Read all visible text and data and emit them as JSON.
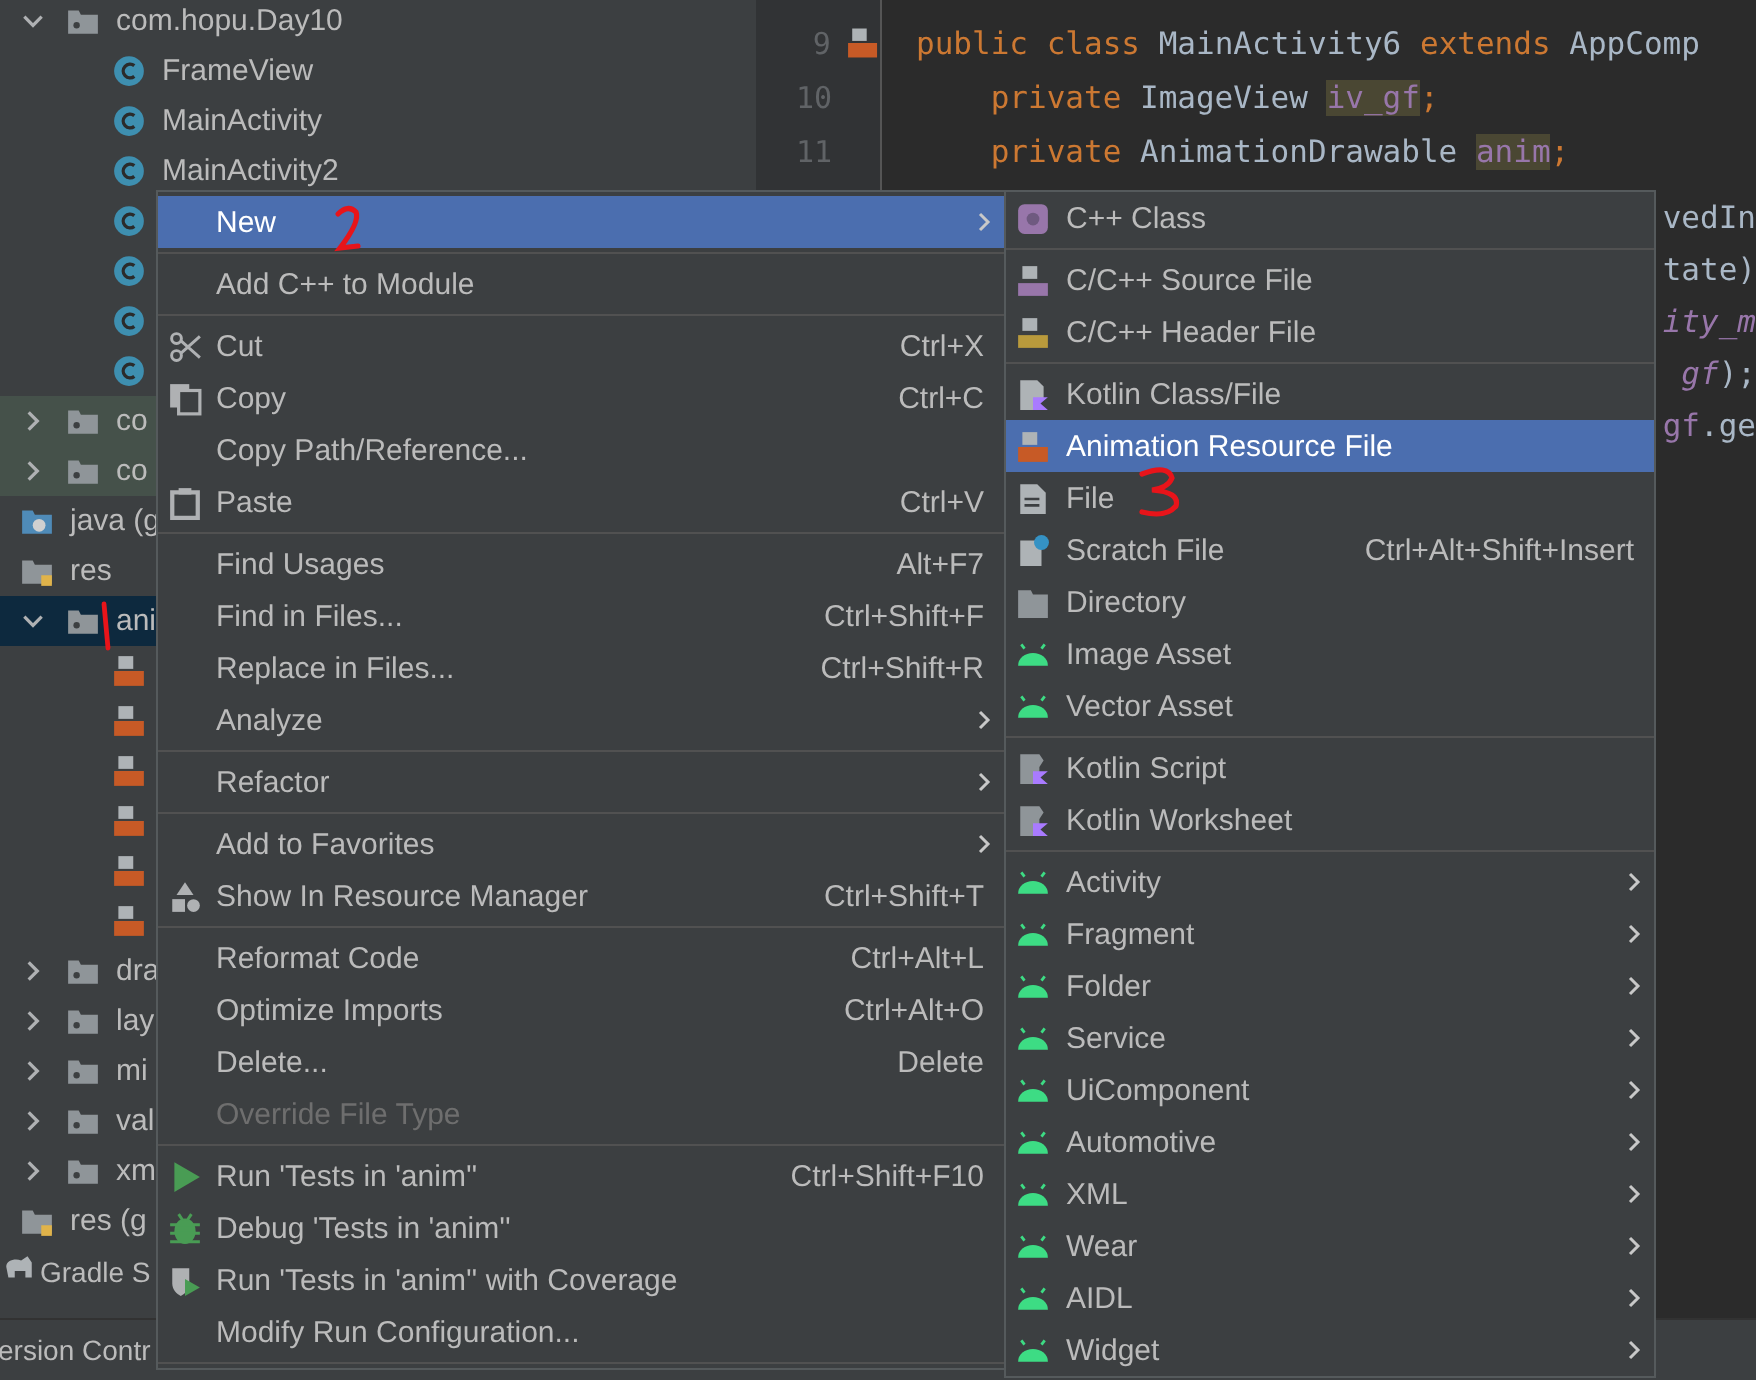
{
  "tree": [
    {
      "label": "com.hopu.Day10",
      "kind": "package",
      "expanded": true,
      "selected": false,
      "highlighted": false,
      "children": [
        {
          "label": "FrameView",
          "kind": "class",
          "selected": false,
          "highlighted": false
        },
        {
          "label": "MainActivity",
          "kind": "class",
          "selected": false,
          "highlighted": false
        },
        {
          "label": "MainActivity2",
          "kind": "class",
          "selected": false,
          "highlighted": false
        },
        {
          "kind": "class",
          "selected": false,
          "highlighted": false
        },
        {
          "kind": "class",
          "selected": false,
          "highlighted": false
        },
        {
          "kind": "class",
          "selected": false,
          "highlighted": false
        },
        {
          "kind": "class",
          "selected": false,
          "highlighted": false
        }
      ]
    },
    {
      "label": "co",
      "kind": "package",
      "expanded": false,
      "selected": false,
      "highlighted": true
    },
    {
      "label": "co",
      "kind": "package",
      "expanded": false,
      "selected": false,
      "highlighted": true
    },
    {
      "label": "java (g",
      "kind": "java-root",
      "selected": false,
      "highlighted": false
    },
    {
      "label": "res",
      "kind": "res-root",
      "selected": false,
      "highlighted": false,
      "children": [
        {
          "label": "ani",
          "kind": "package",
          "expanded": true,
          "selected": true,
          "highlighted": false,
          "children": [
            {
              "kind": "xml-file",
              "selected": false,
              "highlighted": false
            },
            {
              "kind": "xml-file",
              "selected": false,
              "highlighted": false
            },
            {
              "kind": "xml-file",
              "selected": false,
              "highlighted": false
            },
            {
              "kind": "xml-file",
              "selected": false,
              "highlighted": false
            },
            {
              "kind": "xml-file",
              "selected": false,
              "highlighted": false
            },
            {
              "kind": "xml-file",
              "selected": false,
              "highlighted": false
            }
          ]
        },
        {
          "label": "dra",
          "kind": "package",
          "expanded": false,
          "selected": false,
          "highlighted": false
        },
        {
          "label": "lay",
          "kind": "package",
          "expanded": false,
          "selected": false,
          "highlighted": false
        },
        {
          "label": "mi",
          "kind": "package",
          "expanded": false,
          "selected": false,
          "highlighted": false
        },
        {
          "label": "val",
          "kind": "package",
          "expanded": false,
          "selected": false,
          "highlighted": false
        },
        {
          "label": "xm",
          "kind": "package",
          "expanded": false,
          "selected": false,
          "highlighted": false
        }
      ]
    },
    {
      "label": "res (g",
      "kind": "res-root",
      "selected": false,
      "highlighted": false
    },
    {
      "label": "Gradle S",
      "kind": "gradle",
      "selected": false,
      "highlighted": false
    }
  ],
  "bottom_bar": {
    "label": "ersion Contr"
  },
  "editor": {
    "lines": [
      {
        "number": "9",
        "kind": "marked",
        "tokens": [
          {
            "text": "public class ",
            "kind": "keyword"
          },
          {
            "text": "MainActivity6 ",
            "kind": "plain"
          },
          {
            "text": "extends ",
            "kind": "keyword"
          },
          {
            "text": "AppComp",
            "kind": "plain"
          }
        ]
      },
      {
        "number": "10",
        "kind": "plain",
        "tokens": [
          {
            "text": "    private ",
            "kind": "keyword"
          },
          {
            "text": "ImageView ",
            "kind": "plain"
          },
          {
            "text": "iv_gf",
            "kind": "field-highlight"
          },
          {
            "text": ";",
            "kind": "keyword"
          }
        ]
      },
      {
        "number": "11",
        "kind": "plain",
        "tokens": [
          {
            "text": "    private ",
            "kind": "keyword"
          },
          {
            "text": "AnimationDrawable ",
            "kind": "plain"
          },
          {
            "text": "anim",
            "kind": "field-highlight"
          },
          {
            "text": ";",
            "kind": "keyword"
          }
        ]
      }
    ],
    "fragments": [
      {
        "tokens": [
          {
            "text": "vedIn",
            "kind": "plain"
          }
        ]
      },
      {
        "tokens": [
          {
            "text": "tate)",
            "kind": "plain"
          }
        ]
      },
      {
        "tokens": [
          {
            "text": "ity_m",
            "kind": "static"
          }
        ]
      },
      {
        "tokens": [
          {
            "text": "gf",
            "kind": "static"
          },
          {
            "text": ");",
            "kind": "plain"
          }
        ]
      },
      {
        "tokens": [
          {
            "text": "gf",
            "kind": "field"
          },
          {
            "text": ".ge",
            "kind": "plain"
          }
        ]
      }
    ]
  },
  "context_menu": [
    {
      "kind": "plain",
      "label": "New",
      "submenu": true,
      "selected": true,
      "disabled": false
    },
    {
      "kind": "separator"
    },
    {
      "kind": "plain",
      "label": "Add C++ to Module",
      "submenu": false,
      "selected": false,
      "disabled": false
    },
    {
      "kind": "separator"
    },
    {
      "kind": "cut",
      "label": "Cut",
      "shortcut": "Ctrl+X",
      "submenu": false,
      "selected": false,
      "disabled": false
    },
    {
      "kind": "copy",
      "label": "Copy",
      "shortcut": "Ctrl+C",
      "submenu": false,
      "selected": false,
      "disabled": false
    },
    {
      "kind": "plain",
      "label": "Copy Path/Reference...",
      "submenu": false,
      "selected": false,
      "disabled": false
    },
    {
      "kind": "paste",
      "label": "Paste",
      "shortcut": "Ctrl+V",
      "submenu": false,
      "selected": false,
      "disabled": false
    },
    {
      "kind": "separator"
    },
    {
      "kind": "plain",
      "label": "Find Usages",
      "shortcut": "Alt+F7",
      "submenu": false,
      "selected": false,
      "disabled": false
    },
    {
      "kind": "plain",
      "label": "Find in Files...",
      "shortcut": "Ctrl+Shift+F",
      "submenu": false,
      "selected": false,
      "disabled": false
    },
    {
      "kind": "plain",
      "label": "Replace in Files...",
      "shortcut": "Ctrl+Shift+R",
      "submenu": false,
      "selected": false,
      "disabled": false
    },
    {
      "kind": "plain",
      "label": "Analyze",
      "submenu": true,
      "selected": false,
      "disabled": false
    },
    {
      "kind": "separator"
    },
    {
      "kind": "plain",
      "label": "Refactor",
      "submenu": true,
      "selected": false,
      "disabled": false
    },
    {
      "kind": "separator"
    },
    {
      "kind": "plain",
      "label": "Add to Favorites",
      "submenu": true,
      "selected": false,
      "disabled": false
    },
    {
      "kind": "resources",
      "label": "Show In Resource Manager",
      "shortcut": "Ctrl+Shift+T",
      "submenu": false,
      "selected": false,
      "disabled": false
    },
    {
      "kind": "separator"
    },
    {
      "kind": "plain",
      "label": "Reformat Code",
      "shortcut": "Ctrl+Alt+L",
      "submenu": false,
      "selected": false,
      "disabled": false
    },
    {
      "kind": "plain",
      "label": "Optimize Imports",
      "shortcut": "Ctrl+Alt+O",
      "submenu": false,
      "selected": false,
      "disabled": false
    },
    {
      "kind": "plain",
      "label": "Delete...",
      "shortcut": "Delete",
      "submenu": false,
      "selected": false,
      "disabled": false
    },
    {
      "kind": "plain",
      "label": "Override File Type",
      "submenu": false,
      "selected": false,
      "disabled": true
    },
    {
      "kind": "separator"
    },
    {
      "kind": "run",
      "label": "Run 'Tests in 'anim''",
      "shortcut": "Ctrl+Shift+F10",
      "submenu": false,
      "selected": false,
      "disabled": false
    },
    {
      "kind": "debug",
      "label": "Debug 'Tests in 'anim''",
      "submenu": false,
      "selected": false,
      "disabled": false
    },
    {
      "kind": "coverage",
      "label": "Run 'Tests in 'anim'' with Coverage",
      "submenu": false,
      "selected": false,
      "disabled": false
    },
    {
      "kind": "plain",
      "label": "Modify Run Configuration...",
      "submenu": false,
      "selected": false,
      "disabled": false
    },
    {
      "kind": "separator"
    }
  ],
  "new_submenu": [
    {
      "kind": "cpp-class",
      "label": "C++ Class",
      "submenu": false,
      "selected": false
    },
    {
      "kind": "separator"
    },
    {
      "kind": "cpp-source",
      "label": "C/C++ Source File",
      "submenu": false,
      "selected": false
    },
    {
      "kind": "cpp-header",
      "label": "C/C++ Header File",
      "submenu": false,
      "selected": false
    },
    {
      "kind": "separator"
    },
    {
      "kind": "kotlin-file",
      "label": "Kotlin Class/File",
      "submenu": false,
      "selected": false
    },
    {
      "kind": "xml-file",
      "label": "Animation Resource File",
      "submenu": false,
      "selected": true
    },
    {
      "kind": "file",
      "label": "File",
      "submenu": false,
      "selected": false
    },
    {
      "kind": "scratch",
      "label": "Scratch File",
      "shortcut": "Ctrl+Alt+Shift+Insert",
      "submenu": false,
      "selected": false
    },
    {
      "kind": "folder",
      "label": "Directory",
      "submenu": false,
      "selected": false
    },
    {
      "kind": "android",
      "label": "Image Asset",
      "submenu": false,
      "selected": false
    },
    {
      "kind": "android",
      "label": "Vector Asset",
      "submenu": false,
      "selected": false
    },
    {
      "kind": "separator"
    },
    {
      "kind": "kotlin-script",
      "label": "Kotlin Script",
      "submenu": false,
      "selected": false
    },
    {
      "kind": "kotlin-script",
      "label": "Kotlin Worksheet",
      "submenu": false,
      "selected": false
    },
    {
      "kind": "separator"
    },
    {
      "kind": "android",
      "label": "Activity",
      "submenu": true,
      "selected": false
    },
    {
      "kind": "android",
      "label": "Fragment",
      "submenu": true,
      "selected": false
    },
    {
      "kind": "android",
      "label": "Folder",
      "submenu": true,
      "selected": false
    },
    {
      "kind": "android",
      "label": "Service",
      "submenu": true,
      "selected": false
    },
    {
      "kind": "android",
      "label": "UiComponent",
      "submenu": true,
      "selected": false
    },
    {
      "kind": "android",
      "label": "Automotive",
      "submenu": true,
      "selected": false
    },
    {
      "kind": "android",
      "label": "XML",
      "submenu": true,
      "selected": false
    },
    {
      "kind": "android",
      "label": "Wear",
      "submenu": true,
      "selected": false
    },
    {
      "kind": "android",
      "label": "AIDL",
      "submenu": true,
      "selected": false
    },
    {
      "kind": "android",
      "label": "Widget",
      "submenu": true,
      "selected": false
    }
  ]
}
